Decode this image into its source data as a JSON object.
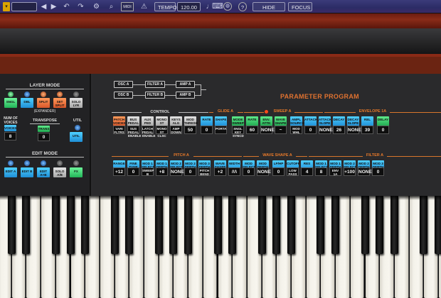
{
  "toolbar": {
    "tempo_label": "TEMPO",
    "tempo_value": "120.00",
    "midi_label": "MIDI",
    "help_label": "?",
    "hide_keyboard_label": "HIDE KEYB",
    "focus_label": "FOCUS"
  },
  "layer_mode": {
    "title": "LAYER MODE",
    "expander": "(EXPANDER)",
    "buttons": [
      "SNGL",
      "DBL",
      "SPLIT",
      "SET SPLIT",
      "SOLO LYR"
    ]
  },
  "voices": {
    "title": "NUM OF VOICES",
    "button": "VOICES",
    "value": "8"
  },
  "transpose": {
    "title": "TRANSPOSE",
    "button": "TRANS",
    "value": "0"
  },
  "util": {
    "title": "UTIL",
    "button": "UTIL"
  },
  "edit_mode": {
    "title": "EDIT MODE",
    "buttons": [
      "EDIT A",
      "EDIT B",
      "EDIT A+B",
      "SOLO A/B",
      "FX"
    ]
  },
  "routing": {
    "osc_a": "OSC A",
    "osc_b": "OSC B",
    "filter_a": "FILTER A",
    "filter_b": "FILTER B",
    "amp_a": "AMP A",
    "amp_b": "AMP B"
  },
  "parameter_program": "PARAMETER PROGRAM",
  "row1": {
    "sections": {
      "control": "CONTROL",
      "glide": "GLIDE A",
      "sweep": "SWEEP A",
      "envelope": "ENVELOPE 1A"
    },
    "buttons": [
      "PATCH VOICES",
      "BUS PEDAL MODE",
      "AUX PED MODE",
      "MONO ST MODE",
      "KEYS ALG",
      "MOD THRESH",
      "RATE",
      "SHAPE",
      "MODE SWEEP",
      "RATE",
      "ENV. ATTK",
      "WAVE SHAPE",
      "AMPL SOURCE",
      "ATTACK",
      "ATTACK SLOPE",
      "DECAY",
      "DECAY SLOPE",
      "REL",
      "DELAY"
    ],
    "values": [
      "VARI FLTRS",
      "SUS PEDAL ENABLE",
      "LATCH PEDAL ENABLE",
      "MONO ST CLSC",
      "AMP DOWN",
      "50",
      "0",
      "PORTA",
      "SNGL KEY SYNCD",
      "60",
      "NONE",
      "~",
      "MOD WHL",
      "0",
      "NONE",
      "26",
      "NONE",
      "39",
      "0"
    ]
  },
  "row2": {
    "sections": {
      "pitch": "PITCH A",
      "wave_shape": "WAVE SHAPE A",
      "filter": "FILTER A"
    },
    "buttons": [
      "RANGE",
      "FINE TUNE",
      "MOD 1 SELECT",
      "MOD 1 DEPTH",
      "MOD 2 SELECT",
      "MOD 2 DEPTH",
      "MOD 3 DEPTH",
      "WAVE SHAPE",
      "WIDTH",
      "MOD SELECT",
      "MOD DEPTH",
      "LP/HP",
      "CUTOFF",
      "RES",
      "MOD 1 SELECT",
      "MOD 1 DEPTH",
      "MOD 2 SELECT",
      "MOD 2 DEPTH",
      "MOD 3 DEPTH"
    ],
    "values": [
      "+12",
      "0",
      "SWEEP B",
      "+8",
      "NONE",
      "0",
      "PITCH BEND",
      "+2",
      "/\\/\\",
      "0",
      "NONE",
      "0",
      "LOW PASS",
      "4",
      "8",
      "ENV 1A",
      "+100",
      "NONE",
      "0"
    ]
  }
}
